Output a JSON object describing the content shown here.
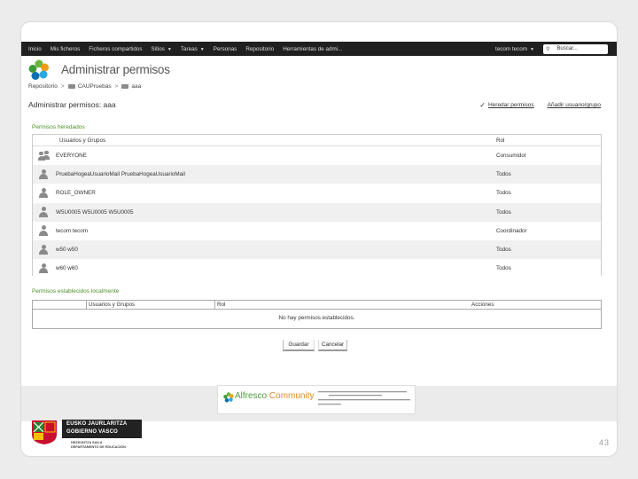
{
  "nav": {
    "items": [
      "Inicio",
      "Mis ficheros",
      "Ficheros compartidos",
      "Sitios",
      "Tareas",
      "Personas",
      "Repositorio",
      "Herramientas de admi..."
    ],
    "dropdowns": [
      false,
      false,
      false,
      true,
      true,
      false,
      false,
      false
    ],
    "user": "tecom tecom",
    "search_placeholder": "Buscar..."
  },
  "page": {
    "title": "Administrar permisos",
    "breadcrumb": [
      "Repositorio",
      "CAUPruebas",
      "aaa"
    ],
    "heading": "Administrar permisos: aaa",
    "inherit_label": "Heredar permisos",
    "add_label": "Añadir usuario/grupo"
  },
  "inherited": {
    "label": "Permisos heredados",
    "col_user": "Usuarios y Grupos",
    "col_role": "Rol",
    "rows": [
      {
        "name": "EVERYONE",
        "role": "Consumidor",
        "icon": "group-icon"
      },
      {
        "name": "PruebaHogeaUsuarioMail PruebaHogeaUsuarioMail",
        "role": "Todos",
        "icon": "user-icon"
      },
      {
        "name": "ROLE_OWNER",
        "role": "Todos",
        "icon": "user-icon"
      },
      {
        "name": "W5U0005 W5U0005 W5U0005",
        "role": "Todos",
        "icon": "user-icon"
      },
      {
        "name": "tecom tecom",
        "role": "Coordinador",
        "icon": "user-icon"
      },
      {
        "name": "w50 w50",
        "role": "Todos",
        "icon": "user-icon"
      },
      {
        "name": "w60 w60",
        "role": "Todos",
        "icon": "user-icon"
      }
    ]
  },
  "local": {
    "label": "Permisos establecidos localmente",
    "col_user": "Usuarios y Grupos",
    "col_role": "Rol",
    "col_actions": "Acciones",
    "empty": "No hay permisos establecidos."
  },
  "buttons": {
    "save": "Guardar",
    "cancel": "Cancelar"
  },
  "footer": {
    "alfresco_brand": "Alfresco",
    "alfresco_community": "Community",
    "gv_line1": "EUSKO JAURLARITZA",
    "gv_line2": "GOBIERNO VASCO",
    "gv_sub1": "HEZKUNTZA SAILA",
    "gv_sub2": "DEPARTAMENTO DE EDUCACIÓN",
    "page_number": "43"
  },
  "colors": {
    "nav_bg": "#202020",
    "section_green": "#4e8f2a",
    "alfresco_green": "#4f9b3d",
    "alfresco_orange": "#e08a1e"
  }
}
